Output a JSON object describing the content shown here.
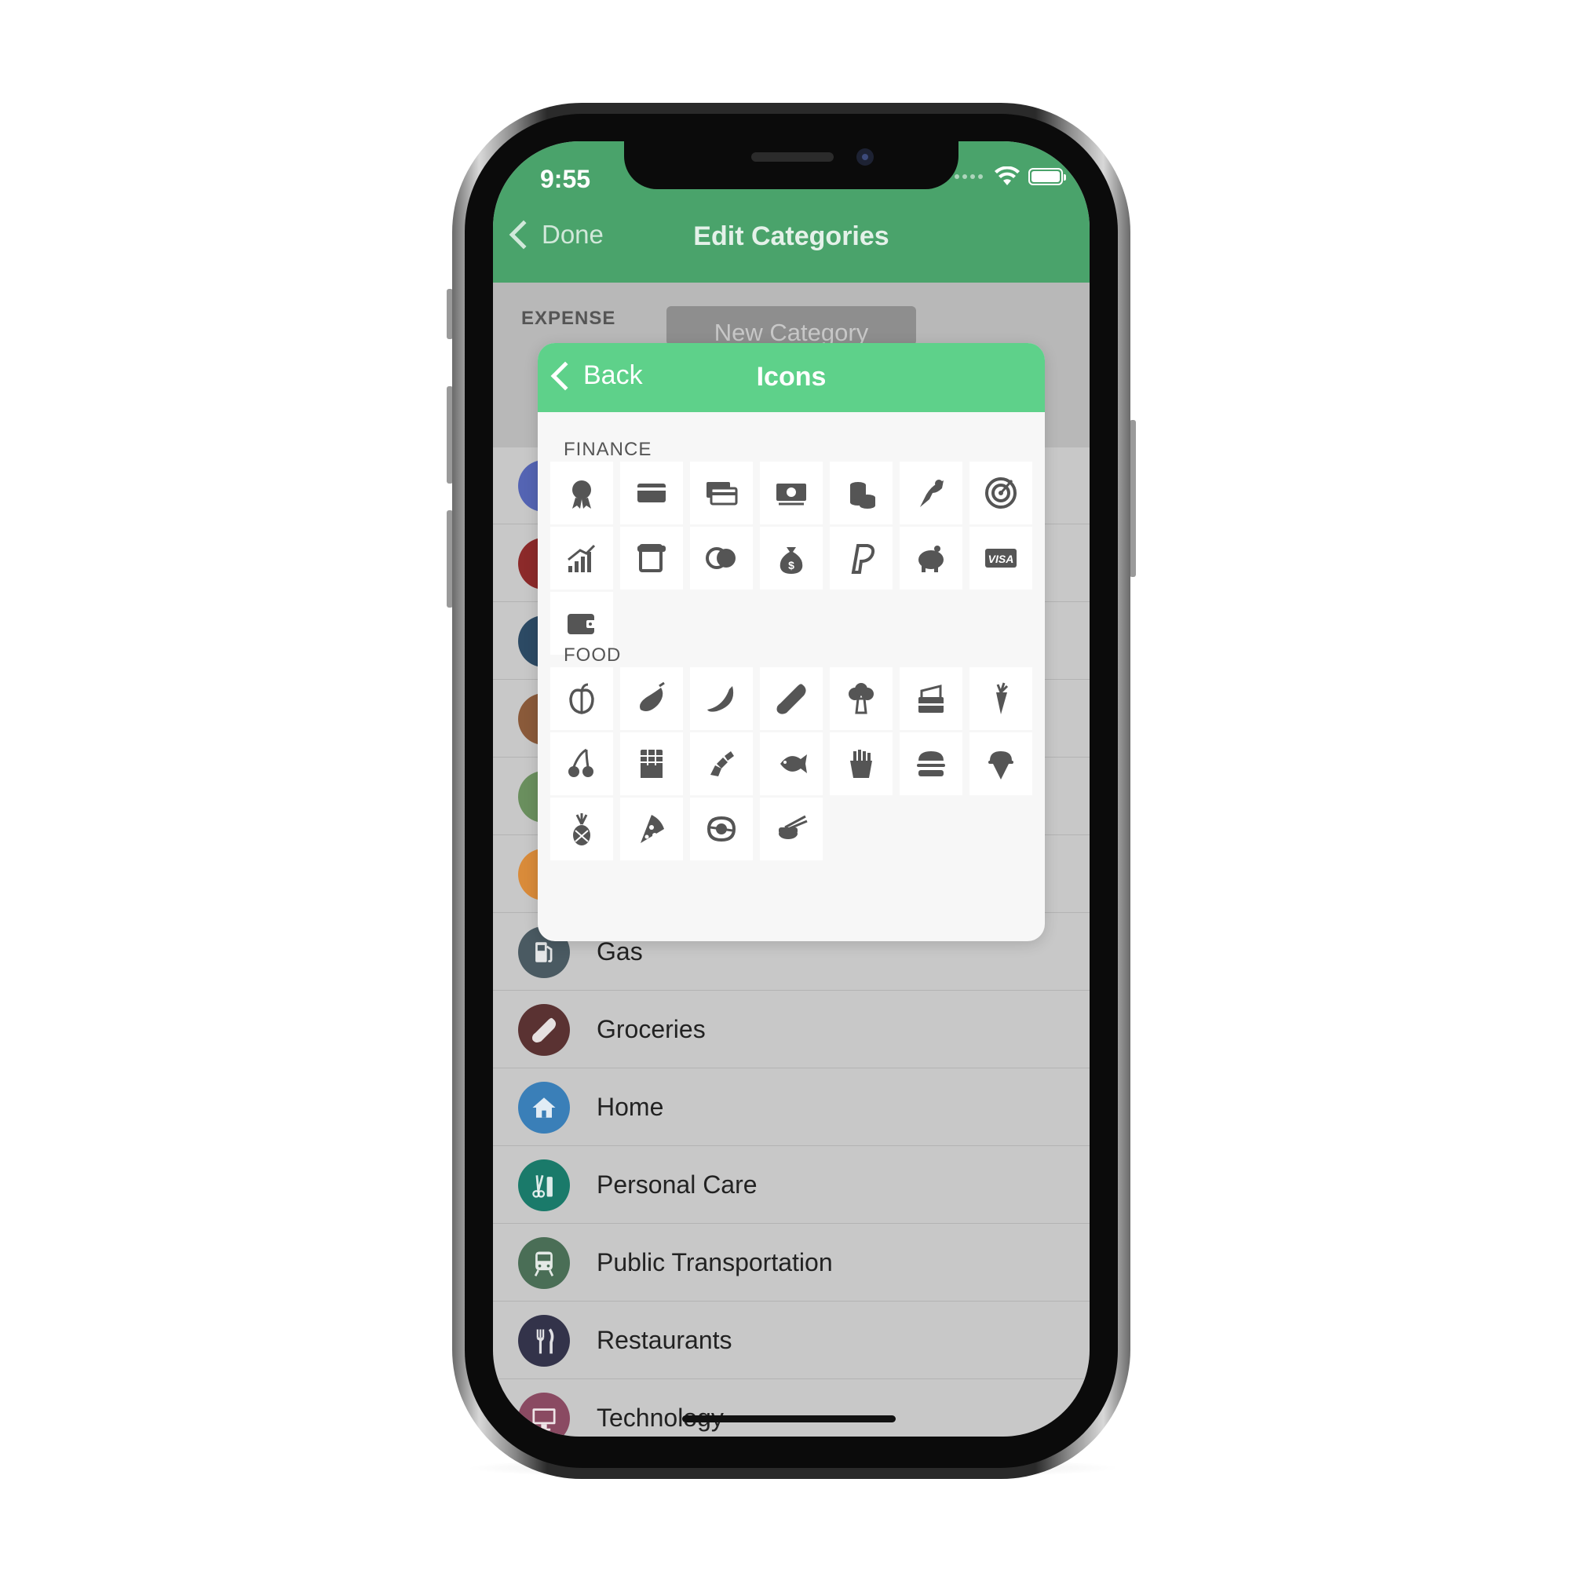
{
  "status_bar": {
    "time": "9:55"
  },
  "nav": {
    "back_label": "Done",
    "title": "Edit Categories"
  },
  "expense": {
    "label": "EXPENSE",
    "new_category_label": "New Category"
  },
  "categories": [
    {
      "label": "",
      "color": "#5464b3",
      "icon": "partial-icon"
    },
    {
      "label": "",
      "color": "#8c2a2a",
      "icon": "partial-icon"
    },
    {
      "label": "",
      "color": "#2c4a64",
      "icon": "partial-icon"
    },
    {
      "label": "",
      "color": "#8a5a3a",
      "icon": "partial-icon"
    },
    {
      "label": "",
      "color": "#6a8f5e",
      "icon": "partial-icon"
    },
    {
      "label": "",
      "color": "#d98b3a",
      "icon": "partial-icon"
    },
    {
      "label": "Gas",
      "color": "#4a5a62",
      "icon": "gas-pump-icon"
    },
    {
      "label": "Groceries",
      "color": "#5a3232",
      "icon": "bread-icon"
    },
    {
      "label": "Home",
      "color": "#3a7fb8",
      "icon": "house-icon"
    },
    {
      "label": "Personal Care",
      "color": "#1a7a6a",
      "icon": "scissors-icon"
    },
    {
      "label": "Public Transportation",
      "color": "#4a6e56",
      "icon": "train-icon"
    },
    {
      "label": "Restaurants",
      "color": "#33334a",
      "icon": "fork-knife-icon"
    },
    {
      "label": "Technology",
      "color": "#8a4a62",
      "icon": "monitor-icon"
    }
  ],
  "popup": {
    "back_label": "Back",
    "title": "Icons",
    "sections": [
      {
        "label": "FINANCE",
        "icons": [
          "award-badge-icon",
          "credit-card-icon",
          "cards-stack-icon",
          "banknote-icon",
          "coins-stack-icon",
          "hand-coin-icon",
          "target-icon",
          "growth-chart-icon",
          "receipt-icon",
          "mastercard-icon",
          "money-bag-icon",
          "paypal-icon",
          "piggy-bank-icon",
          "visa-icon",
          "wallet-icon"
        ]
      },
      {
        "label": "FOOD",
        "icons": [
          "apple-icon",
          "eggplant-icon",
          "banana-icon",
          "baguette-icon",
          "broccoli-icon",
          "cake-icon",
          "carrot-icon",
          "cherry-icon",
          "chocolate-icon",
          "croissant-icon",
          "fish-icon",
          "fries-icon",
          "burger-icon",
          "ice-cream-icon",
          "pineapple-icon",
          "pizza-icon",
          "steak-icon",
          "sushi-icon"
        ]
      }
    ],
    "visa_text": "VISA"
  }
}
